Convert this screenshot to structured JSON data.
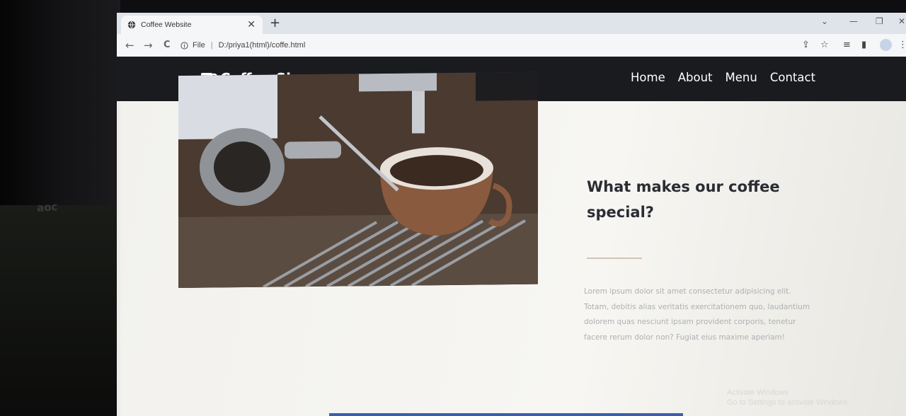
{
  "browser": {
    "tab_title": "Coffee Website",
    "tab_close": "✕",
    "new_tab": "+",
    "url_scheme_label": "File",
    "url": "D:/priya1(html)/coffe.html",
    "back": "←",
    "forward": "→",
    "reload": "C",
    "icons": [
      "globe-icon",
      "info-icon",
      "share-icon",
      "star-icon",
      "reading-list-icon",
      "side-panel-icon",
      "profile-icon",
      "more-icon"
    ]
  },
  "site": {
    "brand": "Coffee Shop",
    "nav": [
      "Home",
      "About",
      "Menu",
      "Contact"
    ],
    "section": {
      "heading": "What makes our coffee special?",
      "paragraph": "Lorem ipsum dolor sit amet consectetur adipisicing elit. Totam, debitis alias veritatis exercitationem quo, laudantium dolorem quas nesciunt ipsam provident corporis, tenetur facere rerum dolor non? Fugiat eius maxime aperiam!"
    },
    "os_watermark": "Activate Windows",
    "os_watermark_sub": "Go to Settings to activate Windows."
  },
  "desk": {
    "monitor_brand": "aoc"
  },
  "colors": {
    "navbar": "#191b1f",
    "heading": "#2a2d33",
    "divider": "#d7c2b5",
    "paragraph": "#aeb0b3"
  }
}
